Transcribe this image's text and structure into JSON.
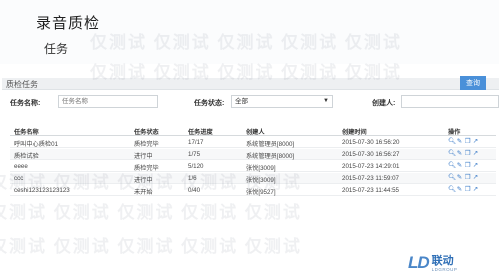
{
  "header": {
    "title": "录音质检",
    "subtitle": "任务"
  },
  "panel": {
    "title": "质检任务",
    "query_label": "查询"
  },
  "filters": {
    "task_name_label": "任务名称:",
    "task_name_placeholder": "任务名称",
    "task_status_label": "任务状态:",
    "task_status_value": "全部",
    "creator_label": "创建人:"
  },
  "table": {
    "columns": [
      "任务名称",
      "任务状态",
      "任务进度",
      "创建人",
      "创建时间",
      "操作"
    ],
    "rows": [
      {
        "name": "呼叫中心质检01",
        "status": "质检完毕",
        "progress": "17/17",
        "creator": "系统管理员[8000]",
        "created": "2015-07-30 16:56:20"
      },
      {
        "name": "质检试验",
        "status": "进行中",
        "progress": "1/75",
        "creator": "系统管理员[8000]",
        "created": "2015-07-30 16:56:27"
      },
      {
        "name": "eeee",
        "status": "质检完毕",
        "progress": "5/120",
        "creator": "张悦[3009]",
        "created": "2015-07-23 14:29:01"
      },
      {
        "name": "ccc",
        "status": "进行中",
        "progress": "1/6",
        "creator": "张悦[3009]",
        "created": "2015-07-23 11:59:07"
      },
      {
        "name": "ceshi123123123123",
        "status": "未开始",
        "progress": "0/40",
        "creator": "张悦[9527]",
        "created": "2015-07-23 11:44:55"
      }
    ]
  },
  "watermark": {
    "text": "仅测试 仅测试 仅测试 仅测试 仅测试"
  },
  "logo": {
    "mark": "LD",
    "cn": "联动",
    "en": "LDGROUP"
  },
  "colors": {
    "accent": "#4a90d9",
    "icon": "#3a7bc8"
  },
  "icons": [
    "search-icon",
    "edit-icon",
    "copy-icon",
    "share-icon"
  ]
}
